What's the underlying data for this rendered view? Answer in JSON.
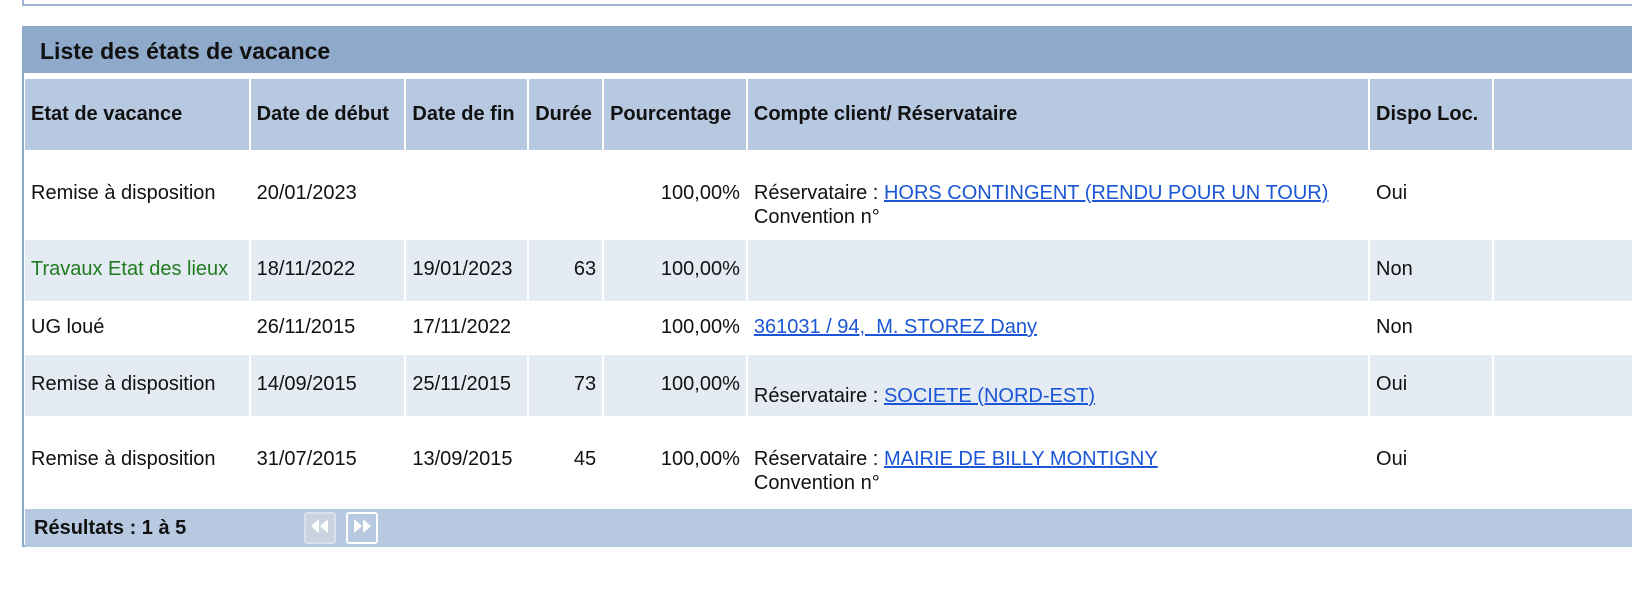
{
  "panel": {
    "title": "Liste des états de vacance"
  },
  "table": {
    "columns": [
      "Etat de vacance",
      "Date de début",
      "Date de fin",
      "Durée",
      "Pourcentage",
      "Compte client/ Réservataire",
      "Dispo Loc."
    ],
    "rows": [
      {
        "etat": "Remise à disposition",
        "debut": "20/01/2023",
        "fin": "",
        "duree": "",
        "pourcentage": "100,00%",
        "compte_prefix": "Réservataire : ",
        "compte_link": "HORS CONTINGENT (RENDU POUR UN TOUR)",
        "compte_extra": "Convention n°",
        "dispo": "Oui"
      },
      {
        "etat": "Travaux Etat des lieux",
        "debut": "18/11/2022",
        "fin": "19/01/2023",
        "duree": "63",
        "pourcentage": "100,00%",
        "compte_prefix": "",
        "compte_link": "",
        "compte_extra": "",
        "dispo": "Non"
      },
      {
        "etat": "UG loué",
        "debut": "26/11/2015",
        "fin": "17/11/2022",
        "duree": "",
        "pourcentage": "100,00%",
        "compte_prefix": "",
        "compte_link": "361031 / 94,  M. STOREZ Dany",
        "compte_extra": "",
        "dispo": "Non"
      },
      {
        "etat": "Remise à disposition",
        "debut": "14/09/2015",
        "fin": "25/11/2015",
        "duree": "73",
        "pourcentage": "100,00%",
        "compte_prefix": "Réservataire : ",
        "compte_link": "SOCIETE (NORD-EST)",
        "compte_extra": "",
        "dispo": "Oui"
      },
      {
        "etat": "Remise à disposition",
        "debut": "31/07/2015",
        "fin": "13/09/2015",
        "duree": "45",
        "pourcentage": "100,00%",
        "compte_prefix": "Réservataire : ",
        "compte_link": "MAIRIE DE BILLY MONTIGNY",
        "compte_extra": "Convention n°",
        "dispo": "Oui"
      }
    ]
  },
  "footer": {
    "results": "Résultats : 1 à 5",
    "first_icon": "first-page-icon",
    "next_icon": "next-page-icon"
  },
  "colors": {
    "header": "#8fa9cb",
    "column_header": "#b7c9e0",
    "alt_row": "#e5ebf3",
    "link": "#1a56d6",
    "green_text": "#1e7b1e"
  }
}
